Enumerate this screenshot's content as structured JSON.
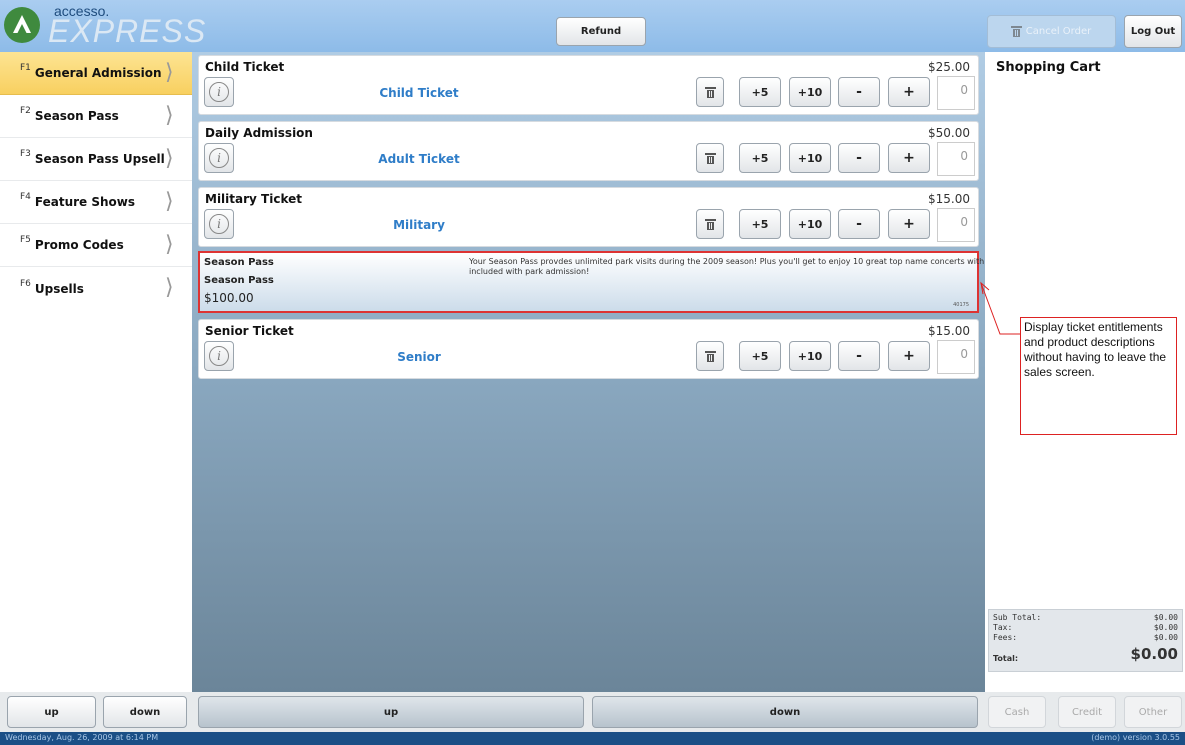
{
  "header": {
    "logo_top": "accesso.",
    "logo_main": "EXPRESS",
    "refund_label": "Refund",
    "cancel_label": "Cancel Order",
    "logout_label": "Log Out"
  },
  "nav": {
    "items": [
      {
        "key": "F1",
        "label": "General Admission",
        "active": true
      },
      {
        "key": "F2",
        "label": "Season Pass"
      },
      {
        "key": "F3",
        "label": "Season Pass Upsell"
      },
      {
        "key": "F4",
        "label": "Feature Shows"
      },
      {
        "key": "F5",
        "label": "Promo Codes"
      },
      {
        "key": "F6",
        "label": "Upsells"
      }
    ],
    "chevron": "⟩"
  },
  "products": [
    {
      "title": "Child Ticket",
      "subtitle": "Child Ticket",
      "price": "$25.00",
      "qty": "0"
    },
    {
      "title": "Daily Admission",
      "subtitle": "Adult Ticket",
      "price": "$50.00",
      "qty": "0"
    },
    {
      "title": "Military Ticket",
      "subtitle": "Military",
      "price": "$15.00",
      "qty": "0"
    },
    {
      "title": "Senior Ticket",
      "subtitle": "Senior",
      "price": "$15.00",
      "qty": "0"
    }
  ],
  "buttons": {
    "plus5": "+5",
    "plus10": "+10",
    "minus": "-",
    "plus": "+",
    "info": "i"
  },
  "season_pass": {
    "title1": "Season Pass",
    "title2": "Season Pass",
    "price": "$100.00",
    "description": "Your Season Pass provdes unlimited park visits during the 2009 season!  Plus you'll get to enjoy 10 great top name concerts with included with park admission!",
    "code": "40175"
  },
  "cart": {
    "title": "Shopping Cart",
    "subtotal_label": "Sub Total:",
    "subtotal": "$0.00",
    "tax_label": "Tax:",
    "tax": "$0.00",
    "fees_label": "Fees:",
    "fees": "$0.00",
    "total_label": "Total:",
    "total": "$0.00"
  },
  "bottom": {
    "up_left": "up",
    "down_left": "down",
    "up_center": "up",
    "down_center": "down",
    "cash": "Cash",
    "credit": "Credit",
    "other": "Other"
  },
  "status": {
    "datetime": "Wednesday, Aug. 26, 2009 at 6:14 PM",
    "version": "(demo)  version 3.0.55"
  },
  "callout": {
    "text": "Display ticket entitlements and product descriptions without having to leave the sales screen."
  },
  "colors": {
    "accent": "#2f7dc8",
    "nav_active": "#f8d060",
    "callout_border": "#dd2222",
    "status_bar": "#1b4f86"
  }
}
